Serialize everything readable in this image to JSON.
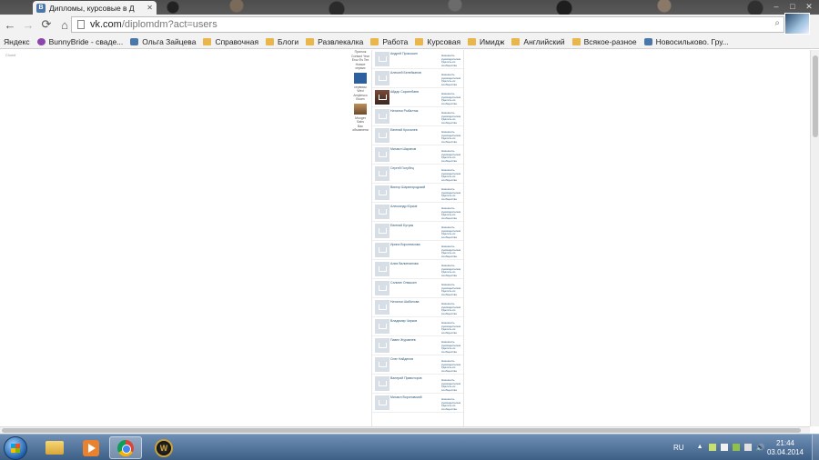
{
  "browser": {
    "tab_title": "Дипломы, курсовые в Д",
    "tab_favicon": "В",
    "url_domain": "vk.com",
    "url_path": "/diplomdm?act=users"
  },
  "bookmarks": [
    {
      "label": "Яндекс",
      "icon": "page"
    },
    {
      "label": "BunnyBride - сваде...",
      "icon": "bb"
    },
    {
      "label": "Ольга Зайцева",
      "icon": "vk"
    },
    {
      "label": "Справочная",
      "icon": "folder"
    },
    {
      "label": "Блоги",
      "icon": "folder"
    },
    {
      "label": "Развлекалка",
      "icon": "folder"
    },
    {
      "label": "Работа",
      "icon": "folder"
    },
    {
      "label": "Курсовая",
      "icon": "folder"
    },
    {
      "label": "Имидж",
      "icon": "folder"
    },
    {
      "label": "Английский",
      "icon": "folder"
    },
    {
      "label": "Всякое-разное",
      "icon": "folder"
    },
    {
      "label": "Новосильково. Гру...",
      "icon": "vk"
    }
  ],
  "page": {
    "corner_text": "Сlowd",
    "left_col": [
      "Прилож",
      "Contact Year",
      "Eroz Es Tex",
      "Новые",
      "сервис",
      "сервисы",
      "Wed",
      "Amplesco",
      "Boom",
      "Mooger",
      "Sabs",
      "Вас",
      "объявлени"
    ]
  },
  "friends": [
    {
      "name": "Андрей Прокошин",
      "actions": "Назначить руководителем Удалить из сообщества",
      "photo": false
    },
    {
      "name": "Алексей Белейканов",
      "actions": "Назначить руководителем Удалить из сообщества",
      "photo": false
    },
    {
      "name": "Айдар Сарсенбаев",
      "actions": "Назначить руководителем Удалить из сообщества",
      "photo": true
    },
    {
      "name": "Наталья Рыбалтак",
      "actions": "Назначить руководителем Удалить из сообщества",
      "photo": false
    },
    {
      "name": "Евгений Крохалев",
      "actions": "Назначить руководителем Удалить из сообщества",
      "photo": false
    },
    {
      "name": "Михаил Шарипов",
      "actions": "Назначить руководителем Удалить из сообщества",
      "photo": false
    },
    {
      "name": "Сергей Голубец",
      "actions": "Назначить руководителем Удалить из сообщества",
      "photo": false
    },
    {
      "name": "Виктор Шарипородский",
      "actions": "Назначить руководителем Удалить из сообщества",
      "photo": false
    },
    {
      "name": "Александр Юрков",
      "actions": "Назначить руководителем Удалить из сообщества",
      "photo": false
    },
    {
      "name": "Евгений Бутрак",
      "actions": "Назначить руководителем Удалить из сообщества",
      "photo": false
    },
    {
      "name": "Ирина Воронникова",
      "actions": "Назначить руководителем Удалить из сообщества",
      "photo": false
    },
    {
      "name": "Алия Валиеханова",
      "actions": "Назначить руководителем Удалить из сообщества",
      "photo": false
    },
    {
      "name": "Салман Оляшкин",
      "actions": "Назначить руководителем Удалить из сообщества",
      "photo": false
    },
    {
      "name": "Наталья Шабалова",
      "actions": "Назначить руководителем Удалить из сообщества",
      "photo": false
    },
    {
      "name": "Владимир Чирков",
      "actions": "Назначить руководителем Удалить из сообщества",
      "photo": false
    },
    {
      "name": "Павел Журавлев",
      "actions": "Назначить руководителем Удалить из сообщества",
      "photo": false
    },
    {
      "name": "Олег Найденов",
      "actions": "Назначить руководителем Удалить из сообщества",
      "photo": false
    },
    {
      "name": "Валерий Правоторов",
      "actions": "Назначить руководителем Удалить из сообщества",
      "photo": false
    },
    {
      "name": "Михаил Вороновский",
      "actions": "Назначить руководителем Удалить из сообщества",
      "photo": false
    }
  ],
  "taskbar": {
    "lang": "RU",
    "time": "21:44",
    "date": "03.04.2014"
  }
}
